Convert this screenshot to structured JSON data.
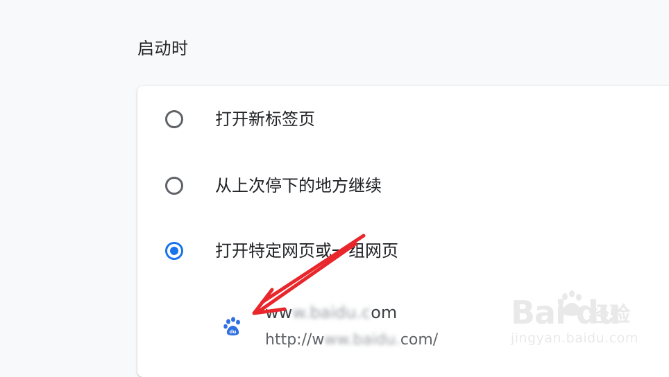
{
  "section": {
    "title": "启动时"
  },
  "startup_options": [
    {
      "label": "打开新标签页",
      "checked": false
    },
    {
      "label": "从上次停下的地方继续",
      "checked": false
    },
    {
      "label": "打开特定网页或一组网页",
      "checked": true
    }
  ],
  "page_entry": {
    "name_prefix": "ww",
    "name_blurred": "w.baidu.c",
    "name_suffix": "om",
    "url_prefix": "http://w",
    "url_blurred": "ww.baidu.",
    "url_suffix": "com/",
    "favicon": "baidu-paw-icon"
  },
  "watermark": {
    "logo": "Bai  du",
    "text": "经验",
    "url": "jingyan.baidu.com"
  },
  "colors": {
    "accent": "#1a73e8",
    "radio_unchecked": "#5f6368",
    "annotation_arrow": "#e8262b",
    "background": "#f8f9fa",
    "card": "#ffffff"
  },
  "icons": {
    "radio_unchecked": "radio-unchecked-icon",
    "radio_checked": "radio-checked-icon",
    "favicon": "baidu-paw-icon",
    "annotation": "red-arrow-icon"
  }
}
